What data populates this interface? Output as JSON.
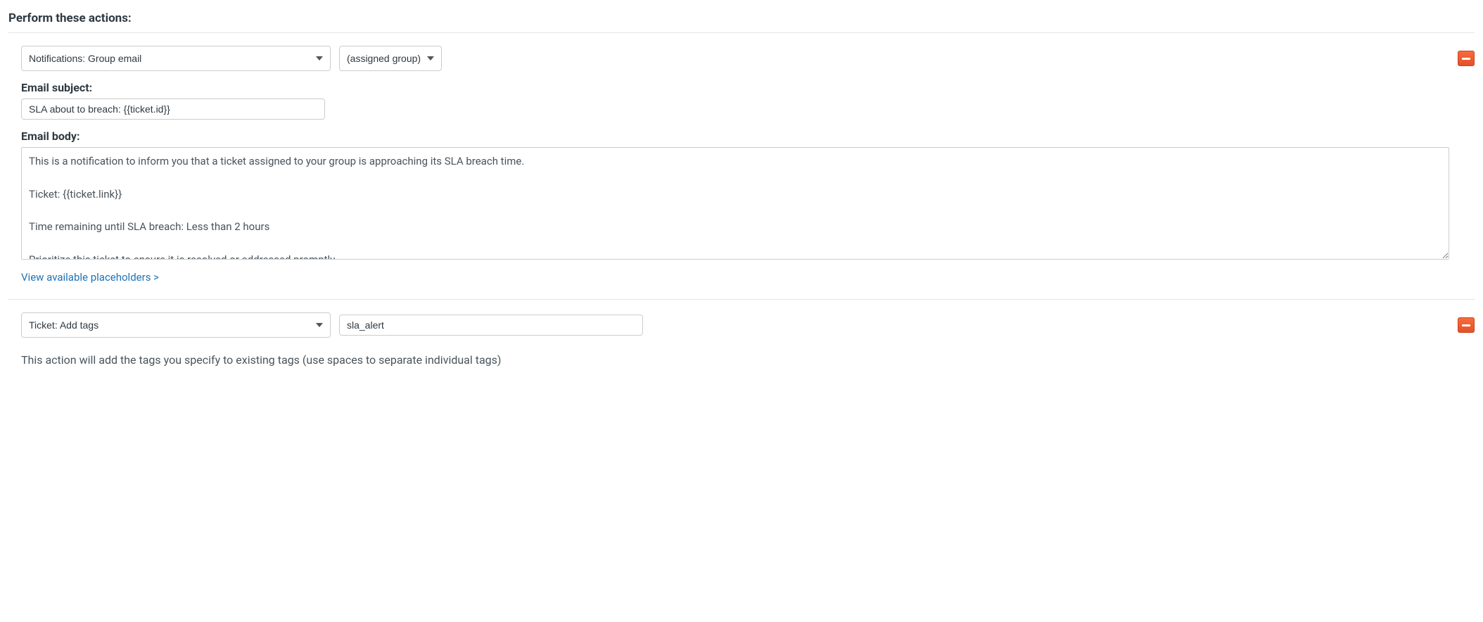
{
  "section_title": "Perform these actions:",
  "action1": {
    "type_selected": "Notifications: Group email",
    "target_selected": "(assigned group)",
    "subject_label": "Email subject:",
    "subject_value": "SLA about to breach: {{ticket.id}}",
    "body_label": "Email body:",
    "body_value": "This is a notification to inform you that a ticket assigned to your group is approaching its SLA breach time.\n\nTicket: {{ticket.link}}\n\nTime remaining until SLA breach: Less than 2 hours\n\nPrioritize this ticket to ensure it is resolved or addressed promptly.",
    "placeholders_link": "View available placeholders >"
  },
  "action2": {
    "type_selected": "Ticket: Add tags",
    "tags_value": "sla_alert",
    "helper": "This action will add the tags you specify to existing tags (use spaces to separate individual tags)"
  }
}
